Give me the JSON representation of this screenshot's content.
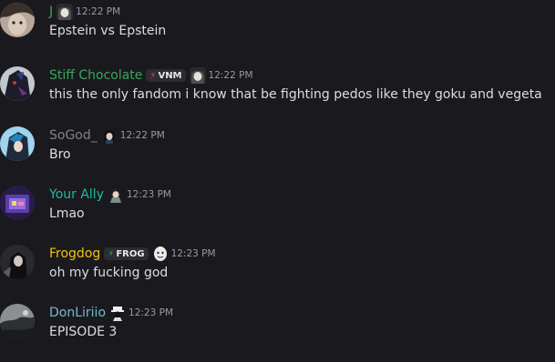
{
  "messages": [
    {
      "username": "J",
      "name_color": "#3ba55d",
      "tag": null,
      "time": "12:22 PM",
      "text": "Epstein vs Epstein",
      "avatar_icon": "anime-face-icon",
      "emoji_icon": "anime-girl-emoji-icon"
    },
    {
      "username": "Stiff Chocolate",
      "name_color": "#3ba55d",
      "tag": "VNM",
      "time": "12:22 PM",
      "text": "this the only fandom i know that be fighting pedos like they goku and vegeta",
      "avatar_icon": "dark-hero-icon",
      "emoji_icon": "anime-girl-emoji-icon"
    },
    {
      "username": "SoGod_",
      "name_color": "#7f8388",
      "tag": null,
      "time": "12:22 PM",
      "text": "Bro",
      "avatar_icon": "blue-character-icon",
      "emoji_icon": "dark-hair-emoji-icon"
    },
    {
      "username": "Your Ally",
      "name_color": "#1abc9c",
      "tag": null,
      "time": "12:23 PM",
      "text": "Lmao",
      "avatar_icon": "purple-frame-icon",
      "emoji_icon": "character-emoji-icon"
    },
    {
      "username": "Frogdog",
      "name_color": "#f1c40f",
      "tag": "FROG",
      "time": "12:23 PM",
      "text": "oh my fucking god",
      "avatar_icon": "dark-figure-icon",
      "emoji_icon": "pale-face-emoji-icon"
    },
    {
      "username": "DonLiriio",
      "name_color": "#74b9cf",
      "tag": null,
      "time": "12:23 PM",
      "text": "EPISODE 3",
      "avatar_icon": "gray-scene-icon",
      "emoji_icon": "hat-figure-emoji-icon"
    }
  ]
}
